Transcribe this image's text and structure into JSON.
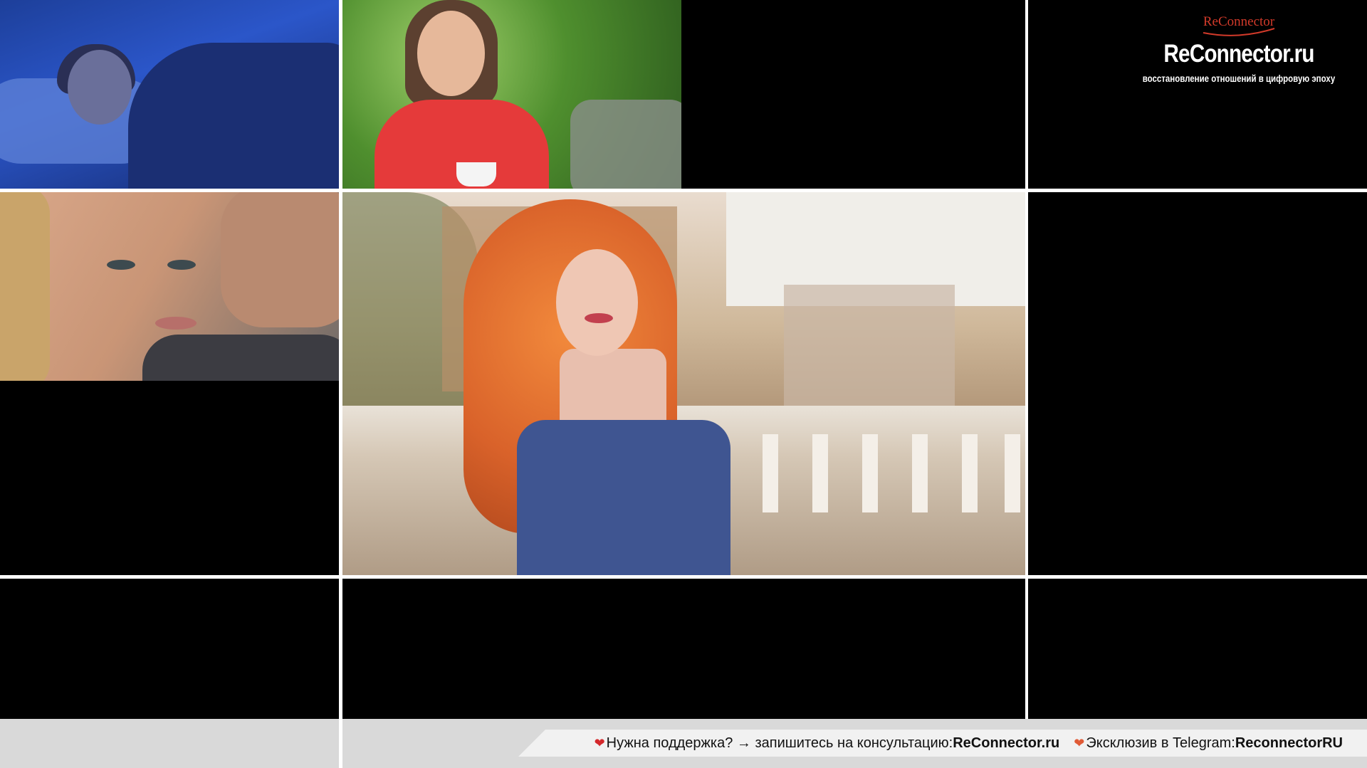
{
  "brand": {
    "small_logo": "ReConnector",
    "title": "ReConnector.ru",
    "tagline": "восстановление отношений в цифровую эпоху"
  },
  "ticker": {
    "support_text": "Нужна поддержка? → запишитесь на консультацию: ",
    "support_link": "ReConnector.ru",
    "telegram_text": "Эксклюзив в Telegram: ",
    "telegram_handle": "ReconnectorRU"
  },
  "icons": {
    "heart1": "broken-heart-icon",
    "heart2": "heart-icon"
  },
  "colors": {
    "accent": "#d23a2a",
    "ticker_bg": "#f1f1f1",
    "grid_gap": "#ffffff"
  }
}
